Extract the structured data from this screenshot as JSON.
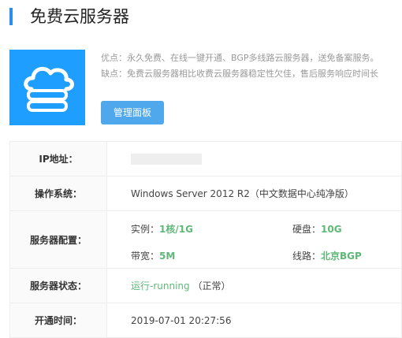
{
  "page": {
    "title": "免费云服务器"
  },
  "hero": {
    "icon": "cloud-server-icon",
    "pros": "优点：永久免费、在线一键开通、BGP多线路云服务器，送免备案服务。",
    "cons": "缺点：免费云服务器相比收费云服务器稳定性欠佳，售后服务响应时间长",
    "button_label": "管理面板"
  },
  "info": {
    "ip_label": "IP地址：",
    "os_label": "操作系统：",
    "os_value": "Windows Server 2012 R2（中文数据中心纯净版）",
    "config_label": "服务器配置：",
    "config": {
      "instance_label": "实例：",
      "instance_value": "1核/1G",
      "disk_label": "硬盘：",
      "disk_value": "10G",
      "bandwidth_label": "带宽：",
      "bandwidth_value": "5M",
      "line_label": "线路：",
      "line_value": "北京BGP"
    },
    "status_label": "服务器状态：",
    "status_value": "运行-running",
    "status_note": "（正常）",
    "time_label": "开通时间：",
    "time_value": "2019-07-01 20:27:56"
  },
  "colors": {
    "accent": "#1e9fff",
    "button": "#4fa8ec",
    "success": "#5fb878"
  }
}
